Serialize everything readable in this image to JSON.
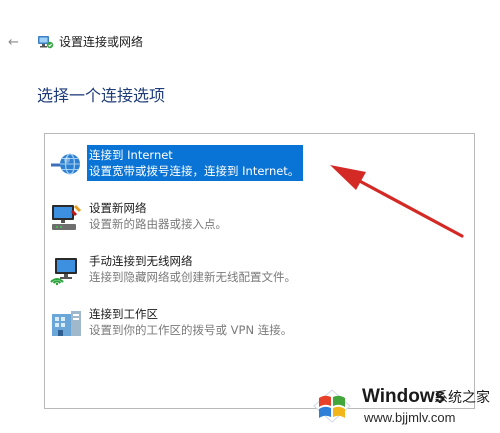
{
  "header": {
    "back_symbol": "←",
    "window_title": "设置连接或网络",
    "title_icon": "network-setup-icon"
  },
  "page": {
    "heading": "选择一个连接选项"
  },
  "options": [
    {
      "label": "连接到 Internet",
      "description": "设置宽带或拨号连接，连接到 Internet。",
      "icon": "globe-internet-icon",
      "selected": true
    },
    {
      "label": "设置新网络",
      "description": "设置新的路由器或接入点。",
      "icon": "router-setup-icon",
      "selected": false
    },
    {
      "label": "手动连接到无线网络",
      "description": "连接到隐藏网络或创建新无线配置文件。",
      "icon": "wireless-monitor-icon",
      "selected": false
    },
    {
      "label": "连接到工作区",
      "description": "设置到你的工作区的拨号或 VPN 连接。",
      "icon": "workplace-vpn-icon",
      "selected": false
    }
  ],
  "colors": {
    "selection": "#0a74d6",
    "heading": "#1f3b7a",
    "annotation_arrow": "#d42a26"
  },
  "watermark": {
    "brand": "Windows",
    "site_name": "系统之家",
    "url": "www.bjjmlv.com",
    "logo_icon": "windows-logo-icon"
  }
}
